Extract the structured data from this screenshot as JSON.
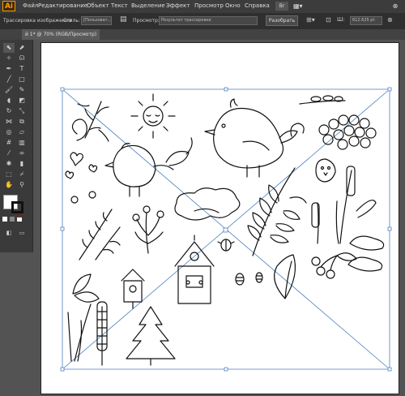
{
  "app": {
    "logo": "Ai"
  },
  "menu": [
    "Файл",
    "Редактирование",
    "Объект",
    "Текст",
    "Выделение",
    "Эффект",
    "Просмотр",
    "Окно",
    "Справка"
  ],
  "controlbar": {
    "trace_label": "Трассировка изображения",
    "style_label": "Стиль:",
    "style_value": "[Пользоват...",
    "view_label": "Просмотр:",
    "view_value": "Результат трассировки",
    "expand_button": "Разобрать",
    "width_value": "612.625 pt"
  },
  "document": {
    "tab_title": "й 1* @ 70% (RGB/Просмотр)"
  },
  "colors": {
    "accent": "#ff9a00",
    "selection": "#4a7fc1"
  }
}
